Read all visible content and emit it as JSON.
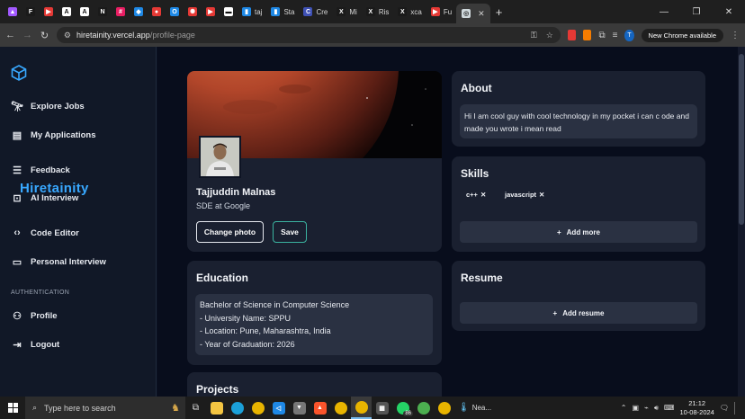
{
  "browser": {
    "tabs": [
      {
        "label": "",
        "color": "#a259ff",
        "glyph": "▲"
      },
      {
        "label": "",
        "color": "#1a1a1a",
        "glyph": "F"
      },
      {
        "label": "",
        "color": "#e53935",
        "glyph": "▶"
      },
      {
        "label": "",
        "color": "#ffffff",
        "glyph": "A"
      },
      {
        "label": "",
        "color": "#ffffff",
        "glyph": "A"
      },
      {
        "label": "",
        "color": "#1a1a1a",
        "glyph": "N"
      },
      {
        "label": "",
        "color": "#e91e63",
        "glyph": "#"
      },
      {
        "label": "",
        "color": "#1e88e5",
        "glyph": "◆"
      },
      {
        "label": "",
        "color": "#e53935",
        "glyph": "●"
      },
      {
        "label": "",
        "color": "#1e88e5",
        "glyph": "O"
      },
      {
        "label": "",
        "color": "#e53935",
        "glyph": "✺"
      },
      {
        "label": "",
        "color": "#e53935",
        "glyph": "▶"
      },
      {
        "label": "",
        "color": "#ffffff",
        "glyph": "▬"
      },
      {
        "label": "taj",
        "color": "#1e88e5",
        "glyph": "▮"
      },
      {
        "label": "Sta",
        "color": "#1e88e5",
        "glyph": "▮"
      },
      {
        "label": "Cre",
        "color": "#3f51b5",
        "glyph": "C"
      },
      {
        "label": "Mi",
        "color": "#1a1a1a",
        "glyph": "X"
      },
      {
        "label": "Ris",
        "color": "#1a1a1a",
        "glyph": "X"
      },
      {
        "label": "xca",
        "color": "#1a1a1a",
        "glyph": "X"
      },
      {
        "label": "Fu",
        "color": "#e53935",
        "glyph": "▶"
      }
    ],
    "active_tab": {
      "label": "",
      "color": "#cfd8dc",
      "glyph": "◎"
    },
    "new_tab": "+",
    "url_host": "hiretainity.vercel.app",
    "url_path": "/profile-page",
    "update_label": "New Chrome available",
    "profile_initial": "T"
  },
  "app": {
    "brand": "Hiretainity",
    "brand_color": "#38a8ff",
    "nav": [
      {
        "label": "Explore Jobs",
        "icon": "telescope-icon"
      },
      {
        "label": "My Applications",
        "icon": "list-box-icon"
      },
      {
        "label": "Feedback",
        "icon": "feedback-icon"
      },
      {
        "label": "AI Interview",
        "icon": "robot-icon"
      },
      {
        "label": "Code Editor",
        "icon": "code-icon"
      },
      {
        "label": "Personal Interview",
        "icon": "video-icon"
      }
    ],
    "auth_label": "AUTHENTICATION",
    "auth_nav": [
      {
        "label": "Profile",
        "icon": "user-icon"
      },
      {
        "label": "Logout",
        "icon": "logout-icon"
      }
    ]
  },
  "profile": {
    "name": "Tajjuddin Malnas",
    "role": "SDE at Google",
    "change_photo": "Change photo",
    "save": "Save"
  },
  "about": {
    "title": "About",
    "text": "Hi I am cool guy with cool technology in my pocket i can c ode and made you wrote i mean read"
  },
  "skills": {
    "title": "Skills",
    "items": [
      "c++",
      "javascript"
    ],
    "add_label": "Add more"
  },
  "education": {
    "title": "Education",
    "lines": [
      "Bachelor of Science in Computer Science",
      "- University Name: SPPU",
      "- Location: Pune, Maharashtra, India",
      "- Year of Graduation: 2026"
    ]
  },
  "resume": {
    "title": "Resume",
    "add_label": "Add resume"
  },
  "projects": {
    "title": "Projects"
  },
  "taskbar": {
    "search_placeholder": "Type here to search",
    "whatsapp_badge": "86",
    "weather": "Nea...",
    "time": "21:12",
    "date": "10-08-2024"
  }
}
